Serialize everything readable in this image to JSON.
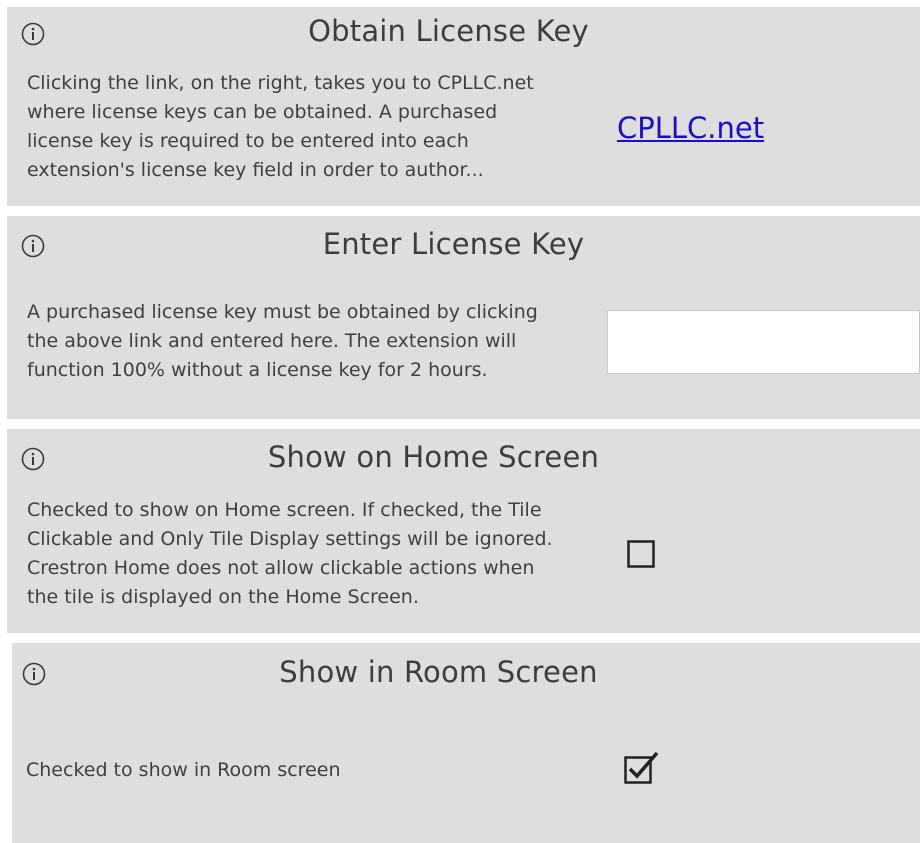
{
  "colors": {
    "panel_bg": "#dedede",
    "text": "#404040",
    "link": "#1a0dcc",
    "input_bg": "#ffffff"
  },
  "panels": [
    {
      "icon": "info-icon",
      "title": "Obtain License Key",
      "description": [
        "Clicking the link, on the right, takes you to CPLLC.net",
        "where license keys can be obtained.  A purchased",
        "license key is required to be entered into each",
        "extension's license key field  in order to author..."
      ],
      "link_text": "CPLLC.net"
    },
    {
      "icon": "info-icon",
      "title": "Enter License Key",
      "description": [
        "A purchased license key must be obtained by clicking",
        "the above link and entered here. The extension will",
        "function 100% without a license key for 2 hours."
      ],
      "input_value": ""
    },
    {
      "icon": "info-icon",
      "title": "Show on Home Screen",
      "description": [
        "Checked to show on Home screen.  If checked, the Tile",
        "Clickable and Only Tile Display settings will be ignored.",
        "Crestron Home does not allow clickable actions when",
        "the tile is displayed on the Home Screen."
      ],
      "checked": false
    },
    {
      "icon": "info-icon",
      "title": "Show in Room Screen",
      "description": [
        "Checked to show in Room screen"
      ],
      "checked": true
    }
  ]
}
